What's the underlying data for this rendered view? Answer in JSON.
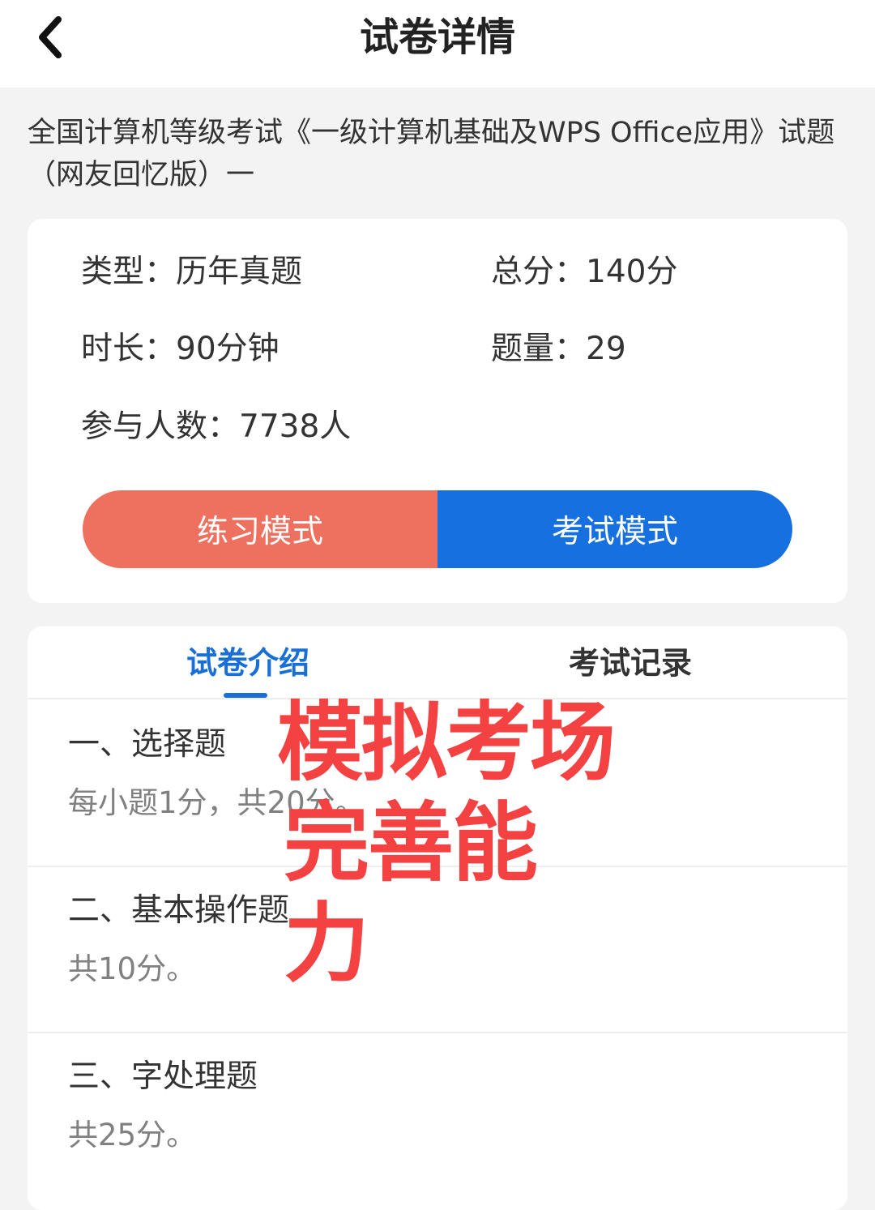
{
  "header": {
    "title": "试卷详情",
    "back_icon": "chevron-left-icon"
  },
  "exam": {
    "title": "全国计算机等级考试《一级计算机基础及WPS Office应用》试题（网友回忆版）一"
  },
  "info": {
    "type": "类型：历年真题",
    "total_score": "总分：140分",
    "duration": "时长：90分钟",
    "question_count": "题量：29",
    "participants": "参与人数：7738人"
  },
  "modes": {
    "practice_label": "练习模式",
    "exam_label": "考试模式",
    "practice_color": "#ee705f",
    "exam_color": "#1670e0"
  },
  "tabs": {
    "intro_label": "试卷介绍",
    "records_label": "考试记录",
    "active": "intro",
    "active_color": "#1a6fd6"
  },
  "sections": [
    {
      "title": "一、选择题",
      "desc": "每小题1分，共20分。"
    },
    {
      "title": "二、基本操作题",
      "desc": "共10分。"
    },
    {
      "title": "三、字处理题",
      "desc": "共25分。"
    }
  ],
  "overlay": {
    "line1": "模拟考场",
    "line2": "完善能力",
    "color": "#f44242"
  }
}
